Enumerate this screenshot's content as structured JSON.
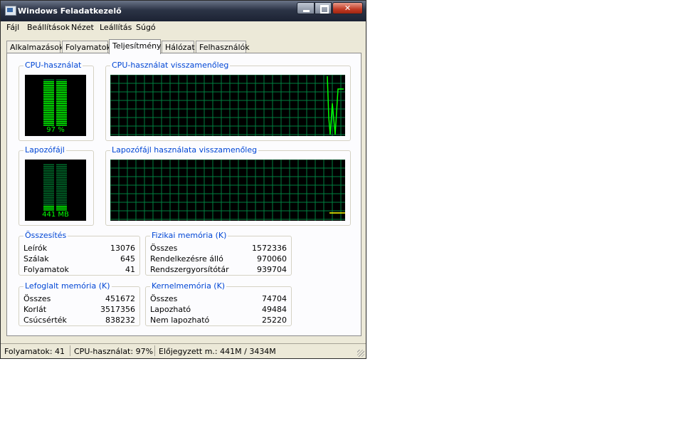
{
  "window": {
    "title": "Windows Feladatkezelő"
  },
  "menu": [
    "Fájl",
    "Beállítások",
    "Nézet",
    "Leállítás",
    "Súgó"
  ],
  "tabs": [
    "Alkalmazások",
    "Folyamatok",
    "Teljesítmény",
    "Hálózat",
    "Felhasználók"
  ],
  "active_tab": "Teljesítmény",
  "cpu": {
    "title": "CPU-használat",
    "value_label": "97 %",
    "level": 0.97,
    "history_title": "CPU-használat visszamenőleg"
  },
  "pagefile": {
    "title": "Lapozófájl",
    "value_label": "441 MB",
    "level": 0.13,
    "history_title": "Lapozófájl használata visszamenőleg"
  },
  "totals": {
    "title": "Összesítés",
    "rows": [
      {
        "k": "Leírók",
        "v": "13076"
      },
      {
        "k": "Szálak",
        "v": "645"
      },
      {
        "k": "Folyamatok",
        "v": "41"
      }
    ]
  },
  "physical": {
    "title": "Fizikai memória (K)",
    "rows": [
      {
        "k": "Összes",
        "v": "1572336"
      },
      {
        "k": "Rendelkezésre álló",
        "v": "970060"
      },
      {
        "k": "Rendszergyorsítótár",
        "v": "939704"
      }
    ]
  },
  "commit": {
    "title": "Lefoglalt memória (K)",
    "rows": [
      {
        "k": "Összes",
        "v": "451672"
      },
      {
        "k": "Korlát",
        "v": "3517356"
      },
      {
        "k": "Csúcsérték",
        "v": "838232"
      }
    ]
  },
  "kernel": {
    "title": "Kernelmemória (K)",
    "rows": [
      {
        "k": "Összes",
        "v": "74704"
      },
      {
        "k": "Lapozható",
        "v": "49484"
      },
      {
        "k": "Nem lapozható",
        "v": "25220"
      }
    ]
  },
  "status": {
    "processes": "Folyamatok: 41",
    "cpu": "CPU-használat: 97%",
    "commit": "Előjegyzett m.: 441M / 3434M"
  },
  "colors": {
    "graph_grid": "#008040",
    "graph_line": "#00ff00",
    "commit_line": "#ffff00",
    "title_text": "#0046d5"
  }
}
